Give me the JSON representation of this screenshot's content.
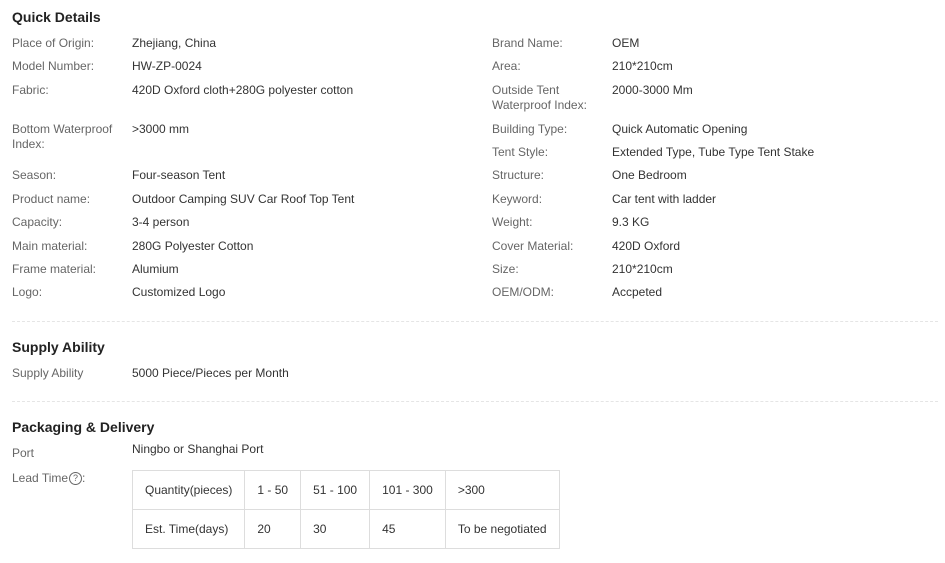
{
  "quick_details": {
    "title": "Quick Details",
    "left": [
      {
        "label": "Place of Origin:",
        "value": "Zhejiang, China"
      },
      {
        "label": "Model Number:",
        "value": "HW-ZP-0024"
      },
      {
        "label": "Fabric:",
        "value": "420D Oxford cloth+280G polyester cotton"
      },
      {
        "label": "Bottom Waterproof Index:",
        "value": ">3000 mm"
      },
      {
        "label": "Season:",
        "value": "Four-season Tent"
      },
      {
        "label": "Product name:",
        "value": "Outdoor Camping SUV Car Roof Top Tent"
      },
      {
        "label": "Capacity:",
        "value": "3-4 person"
      },
      {
        "label": "Main material:",
        "value": "280G Polyester Cotton"
      },
      {
        "label": "Frame material:",
        "value": "Alumium"
      },
      {
        "label": "Logo:",
        "value": "Customized Logo"
      }
    ],
    "right": [
      {
        "label": "Brand Name:",
        "value": "OEM"
      },
      {
        "label": "Area:",
        "value": "210*210cm"
      },
      {
        "label": "Outside Tent Waterproof Index:",
        "value": "2000-3000 Mm"
      },
      {
        "label": "Building Type:",
        "value": "Quick Automatic Opening"
      },
      {
        "label": "Tent Style:",
        "value": "Extended Type, Tube Type Tent Stake"
      },
      {
        "label": "Structure:",
        "value": "One Bedroom"
      },
      {
        "label": "Keyword:",
        "value": "Car tent with ladder"
      },
      {
        "label": "Weight:",
        "value": "9.3 KG"
      },
      {
        "label": "Cover Material:",
        "value": "420D Oxford"
      },
      {
        "label": "Size:",
        "value": "210*210cm"
      },
      {
        "label": "OEM/ODM:",
        "value": "Accpeted"
      }
    ]
  },
  "supply_ability": {
    "title": "Supply Ability",
    "label": "Supply Ability",
    "value": "5000 Piece/Pieces per Month"
  },
  "packaging": {
    "title": "Packaging & Delivery",
    "port_label": "Port",
    "port_value": "Ningbo or Shanghai Port",
    "lead_time_label": "Lead Time",
    "help_icon_glyph": "?",
    "lead_table": {
      "header": [
        "Quantity(pieces)",
        "1 - 50",
        "51 - 100",
        "101 - 300",
        ">300"
      ],
      "row": [
        "Est. Time(days)",
        "20",
        "30",
        "45",
        "To be negotiated"
      ]
    }
  }
}
